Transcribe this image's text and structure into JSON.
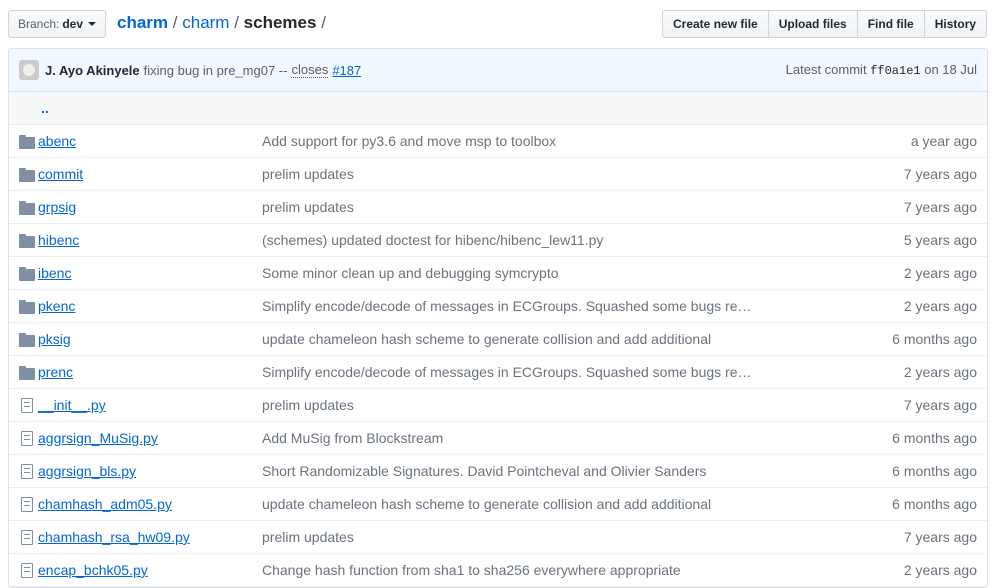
{
  "branch": {
    "label": "Branch:",
    "value": "dev"
  },
  "breadcrumb": {
    "root": "charm",
    "parts": [
      "charm"
    ],
    "current": "schemes",
    "sep": "/"
  },
  "buttons": [
    "Create new file",
    "Upload files",
    "Find file",
    "History"
  ],
  "commit": {
    "author": "J. Ayo Akinyele",
    "message": "fixing bug in pre_mg07 --",
    "closes": "closes",
    "issue": "#187",
    "latest_label": "Latest commit",
    "sha": "ff0a1e1",
    "date": "on 18 Jul"
  },
  "up": "..",
  "rows": [
    {
      "type": "dir",
      "name": "abenc",
      "msg": "Add support for py3.6 and move msp to toolbox",
      "age": "a year ago"
    },
    {
      "type": "dir",
      "name": "commit",
      "msg": "prelim updates",
      "age": "7 years ago"
    },
    {
      "type": "dir",
      "name": "grpsig",
      "msg": "prelim updates",
      "age": "7 years ago"
    },
    {
      "type": "dir",
      "name": "hibenc",
      "msg": "(schemes) updated doctest for hibenc/hibenc_lew11.py",
      "age": "5 years ago"
    },
    {
      "type": "dir",
      "name": "ibenc",
      "msg": "Some minor clean up and debugging symcrypto",
      "age": "2 years ago"
    },
    {
      "type": "dir",
      "name": "pkenc",
      "msg": "Simplify encode/decode of messages in ECGroups. Squashed some bugs re…",
      "age": "2 years ago"
    },
    {
      "type": "dir",
      "name": "pksig",
      "msg": "update chameleon hash scheme to generate collision and add additional",
      "age": "6 months ago"
    },
    {
      "type": "dir",
      "name": "prenc",
      "msg": "Simplify encode/decode of messages in ECGroups. Squashed some bugs re…",
      "age": "2 years ago"
    },
    {
      "type": "file",
      "name": "__init__.py",
      "msg": "prelim updates",
      "age": "7 years ago"
    },
    {
      "type": "file",
      "name": "aggrsign_MuSig.py",
      "msg": "Add MuSig from Blockstream",
      "age": "6 months ago"
    },
    {
      "type": "file",
      "name": "aggrsign_bls.py",
      "msg": "Short Randomizable Signatures. David Pointcheval and Olivier Sanders",
      "age": "6 months ago"
    },
    {
      "type": "file",
      "name": "chamhash_adm05.py",
      "msg": "update chameleon hash scheme to generate collision and add additional",
      "age": "6 months ago"
    },
    {
      "type": "file",
      "name": "chamhash_rsa_hw09.py",
      "msg": "prelim updates",
      "age": "7 years ago"
    },
    {
      "type": "file",
      "name": "encap_bchk05.py",
      "msg": "Change hash function from sha1 to sha256 everywhere appropriate",
      "age": "2 years ago"
    }
  ]
}
